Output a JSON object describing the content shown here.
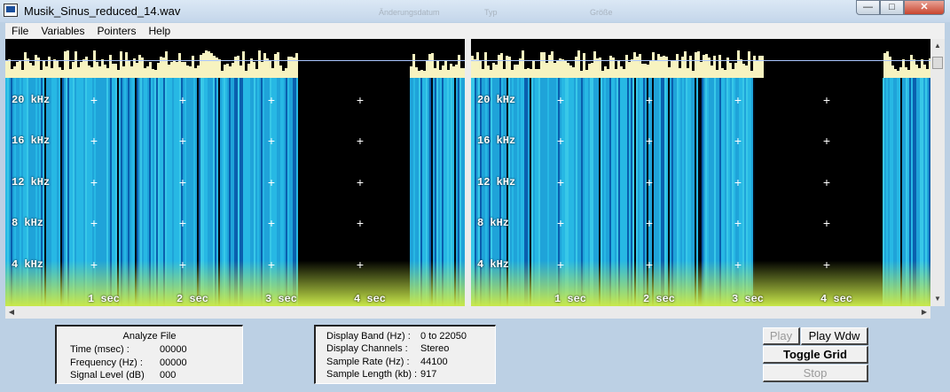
{
  "window": {
    "title": "Musik_Sinus_reduced_14.wav",
    "ghost_texts": [
      "Änderungsdatum",
      "Typ",
      "Größe"
    ]
  },
  "menu": {
    "items": [
      "File",
      "Variables",
      "Pointers",
      "Help"
    ]
  },
  "spectrogram": {
    "freq_labels": [
      "20 kHz",
      "16 kHz",
      "12 kHz",
      "8  kHz",
      "4  kHz"
    ],
    "time_labels": [
      "1  sec",
      "2  sec",
      "3  sec",
      "4  sec"
    ]
  },
  "analyze_panel": {
    "title": "Analyze File",
    "rows": [
      {
        "label": "Time (msec) :",
        "value": "00000"
      },
      {
        "label": "Frequency (Hz) :",
        "value": "00000"
      },
      {
        "label": "Signal Level (dB)",
        "value": "000"
      }
    ]
  },
  "display_panel": {
    "rows": [
      {
        "label": "Display Band (Hz) :",
        "value": "0 to 22050"
      },
      {
        "label": "Display Channels :",
        "value": "Stereo"
      },
      {
        "label": "Sample Rate (Hz) :",
        "value": "44100"
      },
      {
        "label": "Sample Length (kb) :",
        "value": "917"
      }
    ]
  },
  "buttons": {
    "play": "Play",
    "play_wdw": "Play Wdw",
    "toggle_grid": "Toggle Grid",
    "stop": "Stop"
  },
  "colors": {
    "spectrum_base": "#1fa3d9",
    "spectrum_low": "#c9e84a",
    "wave": "#f7f3c0",
    "background": "#bcd0e4"
  }
}
